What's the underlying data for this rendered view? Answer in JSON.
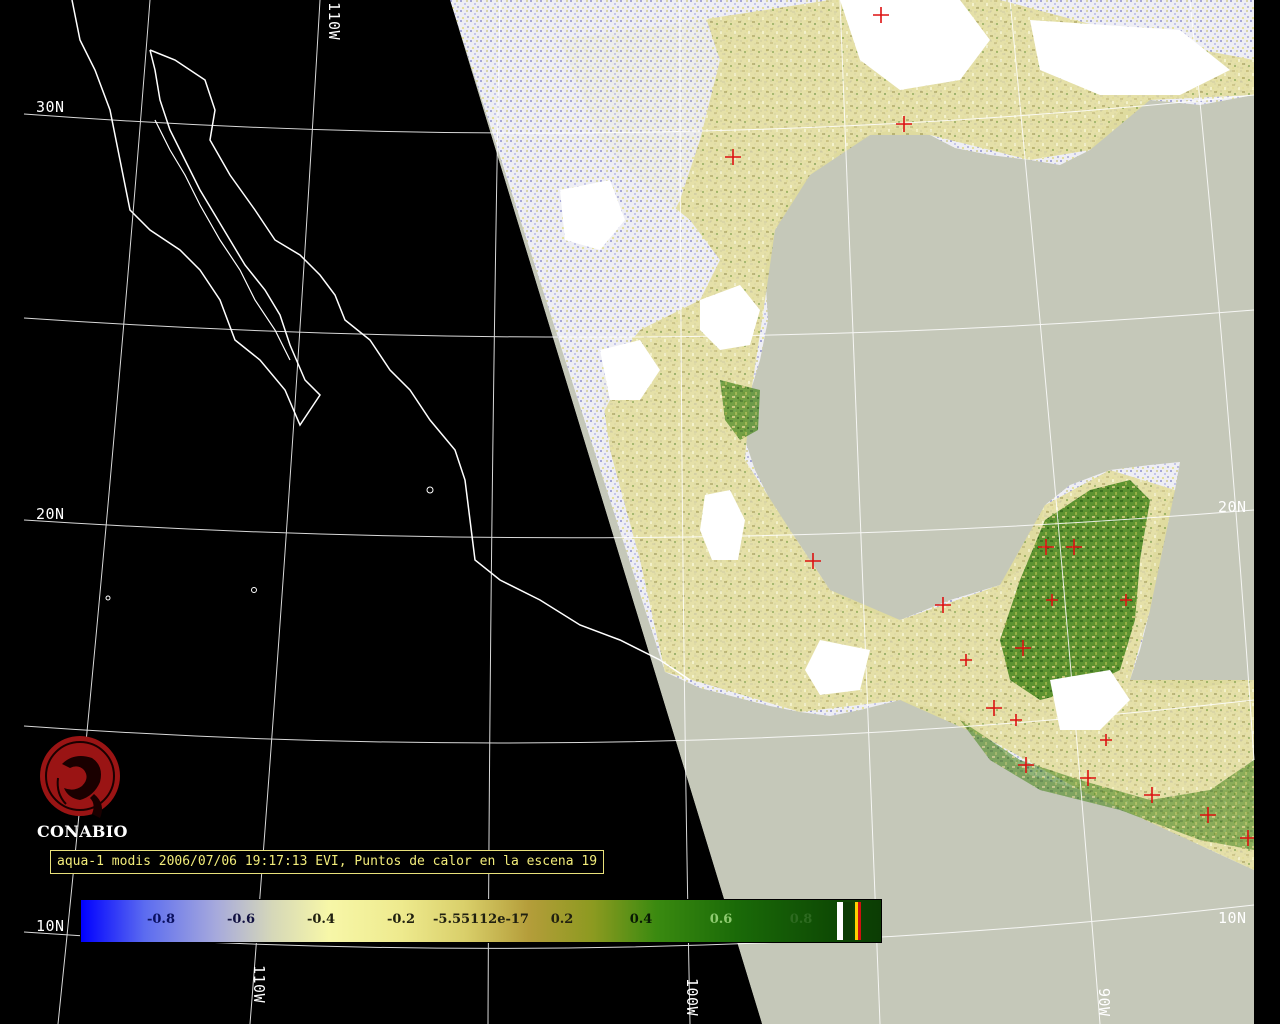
{
  "map": {
    "title_caption": "aqua-1 modis 2006/07/06 19:17:13 EVI, Puntos de calor en la escena 19",
    "organization": "CONABIO",
    "grid_labels": {
      "lat_30n": "30N",
      "lat_20n_left": "20N",
      "lat_20n_right": "20N",
      "lat_10n_left": "10N",
      "lat_10n_right": "10N",
      "lon_110w_top": "110W",
      "lon_110w_bottom": "110W",
      "lon_100w_bottom": "100W",
      "lon_90w_bottom": "90W"
    },
    "colors": {
      "background": "#000000",
      "ocean_gray": "#c5c8b9",
      "coastline": "#ffffff",
      "cloud_white": "#ffffff",
      "hotspot": "#dd1111",
      "caption_text": "#f2ec7a",
      "logo_red": "#9a1414"
    },
    "icons": [
      "conabio-logo-icon",
      "hotspot-cross-icon"
    ]
  },
  "colorbar": {
    "ticks": [
      "-0.8",
      "-0.6",
      "-0.4",
      "-0.2",
      "-5.55112e-17",
      "0.2",
      "0.4",
      "0.6",
      "0.8"
    ],
    "tick_colors": [
      "#0a1060",
      "#101040",
      "#202010",
      "#202010",
      "#202010",
      "#202010",
      "#081a04",
      "#8ecb70",
      "#2d6a20"
    ],
    "range": [
      -1,
      1
    ],
    "stripes": [
      "#ffffff",
      "#0c3c04",
      "#ffd000",
      "#d01010"
    ]
  },
  "hotspots_count": 19
}
